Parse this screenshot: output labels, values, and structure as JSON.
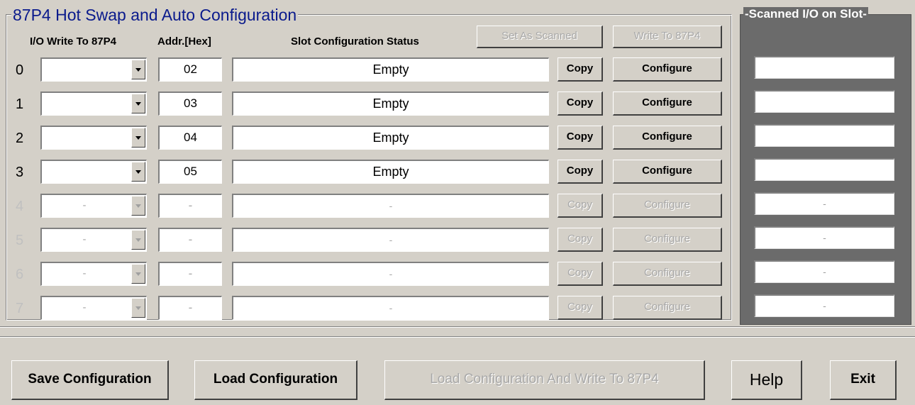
{
  "group_title": "87P4 Hot Swap and Auto Configuration",
  "headers": {
    "io_write": "I/O Write To 87P4",
    "addr": "Addr.[Hex]",
    "status": "Slot Configuration Status"
  },
  "top_buttons": {
    "set_as_scanned": "Set As Scanned",
    "write_to_87p4": "Write To 87P4"
  },
  "rows": [
    {
      "slot": "0",
      "combo": "",
      "addr": "02",
      "status": "Empty",
      "copy": "Copy",
      "configure": "Configure",
      "enabled": true
    },
    {
      "slot": "1",
      "combo": "",
      "addr": "03",
      "status": "Empty",
      "copy": "Copy",
      "configure": "Configure",
      "enabled": true
    },
    {
      "slot": "2",
      "combo": "",
      "addr": "04",
      "status": "Empty",
      "copy": "Copy",
      "configure": "Configure",
      "enabled": true
    },
    {
      "slot": "3",
      "combo": "",
      "addr": "05",
      "status": "Empty",
      "copy": "Copy",
      "configure": "Configure",
      "enabled": true
    },
    {
      "slot": "4",
      "combo": "-",
      "addr": "-",
      "status": "-",
      "copy": "Copy",
      "configure": "Configure",
      "enabled": false
    },
    {
      "slot": "5",
      "combo": "-",
      "addr": "-",
      "status": "-",
      "copy": "Copy",
      "configure": "Configure",
      "enabled": false
    },
    {
      "slot": "6",
      "combo": "-",
      "addr": "-",
      "status": "-",
      "copy": "Copy",
      "configure": "Configure",
      "enabled": false
    },
    {
      "slot": "7",
      "combo": "-",
      "addr": "-",
      "status": "-",
      "copy": "Copy",
      "configure": "Configure",
      "enabled": false
    }
  ],
  "scan_panel": {
    "title": "Scanned I/O on Slot",
    "values": [
      "",
      "",
      "",
      "",
      "-",
      "-",
      "-",
      "-"
    ]
  },
  "bottom": {
    "save": "Save Configuration",
    "load": "Load Configuration",
    "load_write": "Load  Configuration And Write To 87P4",
    "help": "Help",
    "exit": "Exit"
  }
}
